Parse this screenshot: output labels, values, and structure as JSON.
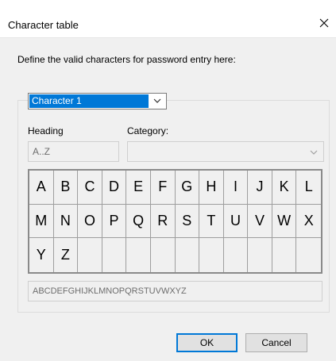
{
  "dialog": {
    "title": "Character table",
    "instruction": "Define the valid characters for password entry here:"
  },
  "character_select": {
    "value": "Character 1"
  },
  "heading": {
    "label": "Heading",
    "value": "A..Z"
  },
  "category": {
    "label": "Category:",
    "value": ""
  },
  "grid": {
    "cells": [
      "A",
      "B",
      "C",
      "D",
      "E",
      "F",
      "G",
      "H",
      "I",
      "J",
      "K",
      "L",
      "M",
      "N",
      "O",
      "P",
      "Q",
      "R",
      "S",
      "T",
      "U",
      "V",
      "W",
      "X",
      "Y",
      "Z",
      "",
      "",
      "",
      "",
      "",
      "",
      "",
      "",
      "",
      ""
    ]
  },
  "summary": {
    "value": "ABCDEFGHIJKLMNOPQRSTUVWXYZ"
  },
  "buttons": {
    "ok": "OK",
    "cancel": "Cancel"
  },
  "icons": {
    "close": "close-icon",
    "dropdown": "chevron-down-icon"
  }
}
